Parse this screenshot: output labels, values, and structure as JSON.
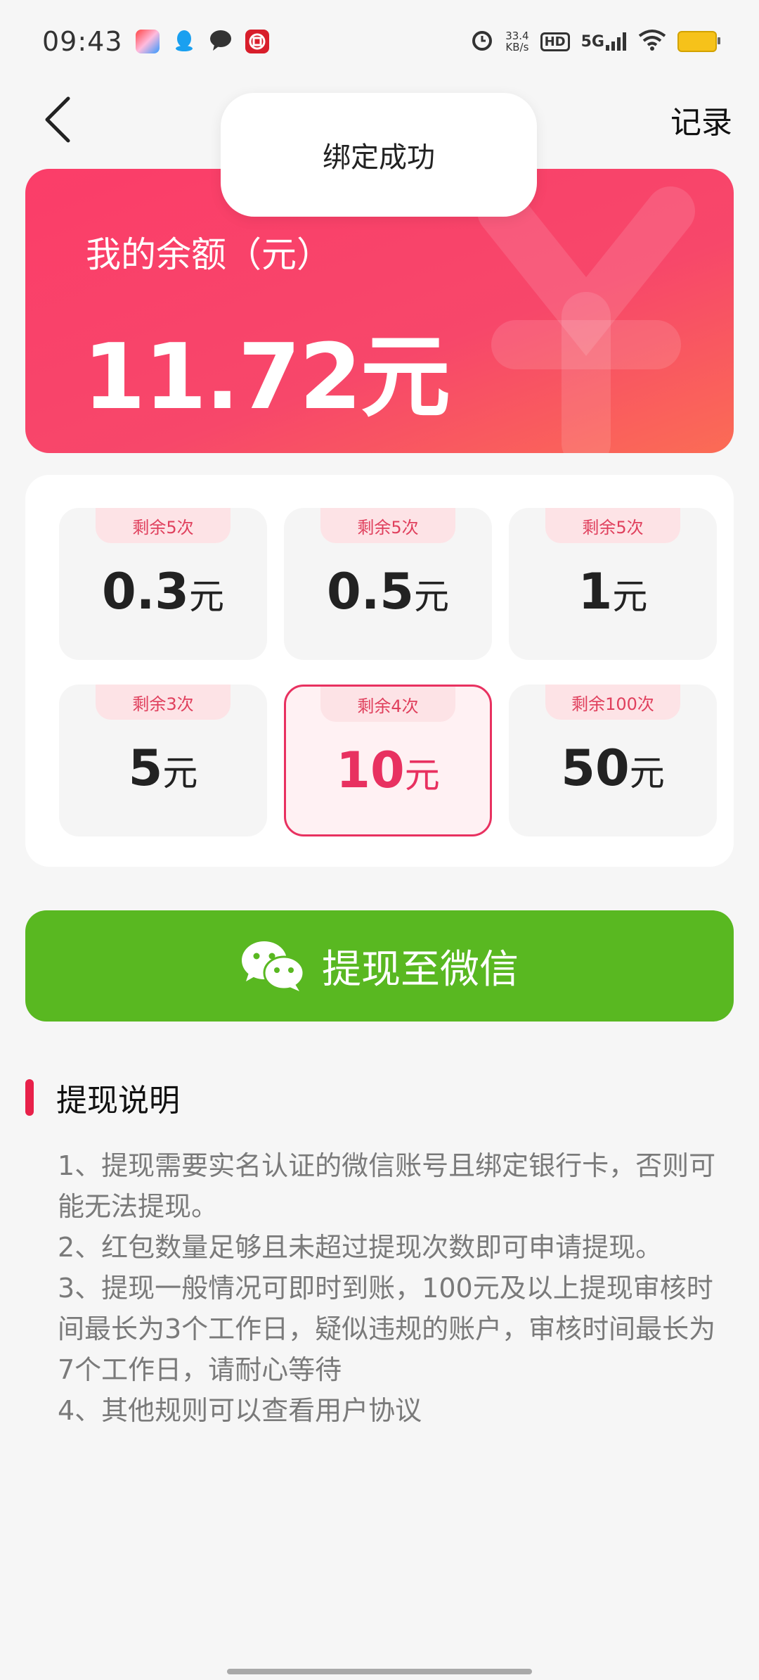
{
  "status_bar": {
    "time": "09:43",
    "net_speed_value": "33.4",
    "net_speed_unit": "KB/s",
    "hd_label": "HD",
    "network_label": "5G"
  },
  "nav": {
    "record_label": "记录"
  },
  "toast": {
    "message": "绑定成功"
  },
  "balance": {
    "label": "我的余额（元）",
    "amount": "11.72元"
  },
  "options": [
    {
      "remaining": "剩余5次",
      "value": "0.3",
      "unit": "元",
      "selected": false
    },
    {
      "remaining": "剩余5次",
      "value": "0.5",
      "unit": "元",
      "selected": false
    },
    {
      "remaining": "剩余5次",
      "value": "1",
      "unit": "元",
      "selected": false
    },
    {
      "remaining": "剩余3次",
      "value": "5",
      "unit": "元",
      "selected": false
    },
    {
      "remaining": "剩余4次",
      "value": "10",
      "unit": "元",
      "selected": true
    },
    {
      "remaining": "剩余100次",
      "value": "50",
      "unit": "元",
      "selected": false
    }
  ],
  "withdraw": {
    "label": "提现至微信",
    "icon": "wechat-icon"
  },
  "notes": {
    "title": "提现说明",
    "items": [
      "1、提现需要实名认证的微信账号且绑定银行卡，否则可能无法提现。",
      "2、红包数量足够且未超过提现次数即可申请提现。",
      "3、提现一般情况可即时到账，100元及以上提现审核时间最长为3个工作日，疑似违规的账户，审核时间最长为7个工作日，请耐心等待",
      "4、其他规则可以查看用户协议"
    ]
  },
  "colors": {
    "accent": "#e83160",
    "card_gradient_start": "#fb3d69",
    "card_gradient_end": "#fb6c55",
    "wechat_green": "#59b821"
  }
}
